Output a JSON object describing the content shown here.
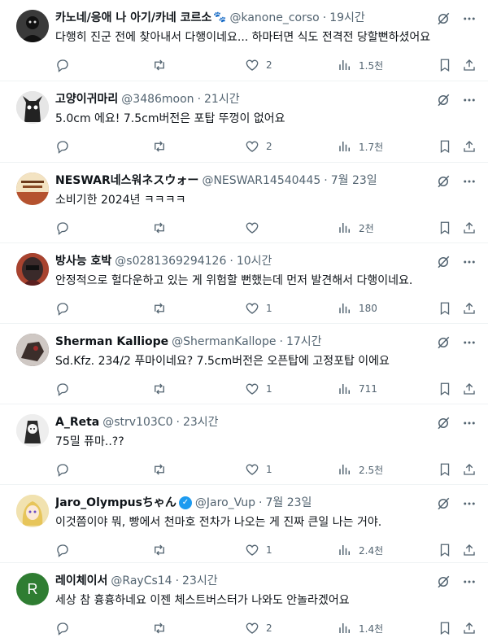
{
  "replies": [
    {
      "name": "카노네/응애 나 아기/카네 코르소",
      "emoji": "🐾",
      "handle": "@kanone_corso",
      "time": "19시간",
      "text": "다행히 진군 전에 찾아내서 다행이네요... 하마터면 식도 전격전 당할뻔하셨어요",
      "reply_count": "",
      "retweet_count": "",
      "like_count": "2",
      "view_count": "1.5천",
      "avatar_color": "#2b2b2b",
      "verified": false
    },
    {
      "name": "고양이귀마리",
      "emoji": "",
      "handle": "@3486moon",
      "time": "21시간",
      "text": "5.0cm 에요! 7.5cm버전은 포탑 뚜껑이 없어요",
      "reply_count": "",
      "retweet_count": "",
      "like_count": "2",
      "view_count": "1.7천",
      "avatar_color": "#d9d9d9",
      "verified": false
    },
    {
      "name": "NESWAR네스워ネスウォー",
      "emoji": "",
      "handle": "@NESWAR14540445",
      "time": "7월 23일",
      "text": "소비기한 2024년 ㅋㅋㅋㅋ",
      "reply_count": "",
      "retweet_count": "",
      "like_count": "",
      "view_count": "2천",
      "avatar_color": "#b5722f",
      "verified": false
    },
    {
      "name": "방사능 호박",
      "emoji": "",
      "handle": "@s0281369294126",
      "time": "10시간",
      "text": "안정적으로 헐다운하고 있는 게 위험할 뻔했는데 먼저 발견해서 다행이네요.",
      "reply_count": "",
      "retweet_count": "",
      "like_count": "1",
      "view_count": "180",
      "avatar_color": "#7a2e2a",
      "verified": false
    },
    {
      "name": "Sherman Kalliope",
      "emoji": "",
      "handle": "@ShermanKallope",
      "time": "17시간",
      "text": "Sd.Kfz. 234/2 푸마이네요? 7.5cm버전은 오픈탑에 고정포탑 이에요",
      "reply_count": "",
      "retweet_count": "",
      "like_count": "1",
      "view_count": "711",
      "avatar_color": "#4a3a35",
      "verified": false
    },
    {
      "name": "A_Reta",
      "emoji": "",
      "handle": "@strv103C0",
      "time": "23시간",
      "text": "75밀 퓨마..??",
      "reply_count": "",
      "retweet_count": "",
      "like_count": "1",
      "view_count": "2.5천",
      "avatar_color": "#e9e9e9",
      "verified": false
    },
    {
      "name": "Jaro_Olympusちゃん",
      "emoji": "",
      "handle": "@Jaro_Vup",
      "time": "7월 23일",
      "text": "이것쯤이야 뭐, 빵에서 천마호 전차가 나오는 게 진짜 큰일 나는 거야.",
      "reply_count": "",
      "retweet_count": "",
      "like_count": "1",
      "view_count": "2.4천",
      "avatar_color": "#e8d18a",
      "verified": true
    },
    {
      "name": "레이체이서",
      "emoji": "",
      "handle": "@RayCs14",
      "time": "23시간",
      "text": "세상 참 흉흉하네요 이젠 체스트버스터가 나와도 안놀라겠어요",
      "reply_count": "",
      "retweet_count": "",
      "like_count": "2",
      "view_count": "1.4천",
      "avatar_color": "#2f7d32",
      "avatar_letter": "R",
      "verified": false
    }
  ],
  "icons": {
    "reply": "reply-icon",
    "retweet": "retweet-icon",
    "like": "heart-icon",
    "views": "views-icon",
    "bookmark": "bookmark-icon",
    "share": "share-icon",
    "grok": "grok-icon",
    "more": "more-icon"
  }
}
